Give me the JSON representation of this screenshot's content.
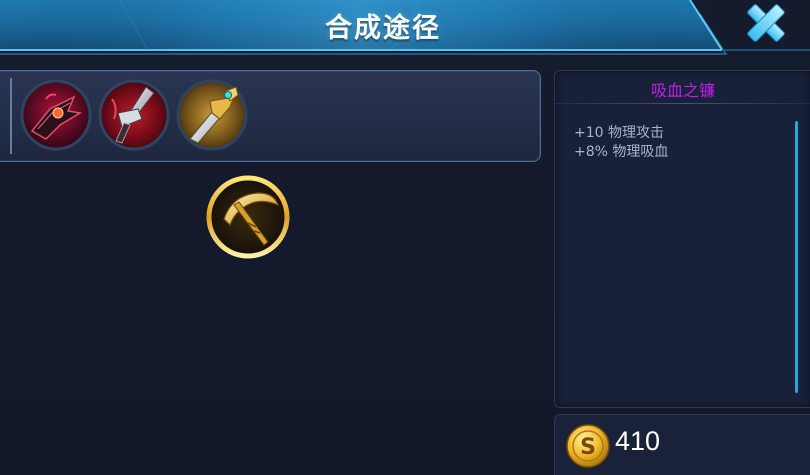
{
  "header": {
    "title": "合成途径",
    "close_icon": "close-x-icon"
  },
  "recipe": {
    "components": [
      {
        "icon": "dark-crimson-blade-icon"
      },
      {
        "icon": "silver-crimson-sword-icon"
      },
      {
        "icon": "golden-jewel-sword-icon"
      }
    ],
    "result": {
      "icon": "golden-scythe-icon"
    }
  },
  "item_detail": {
    "name": "吸血之镰",
    "name_color": "#c51ee6",
    "stats": [
      "+10 物理攻击",
      "+8% 物理吸血"
    ],
    "price": "410",
    "currency_icon": "gold-coin-icon"
  },
  "colors": {
    "accent": "#2ba4d8",
    "background": "#141b2c"
  }
}
